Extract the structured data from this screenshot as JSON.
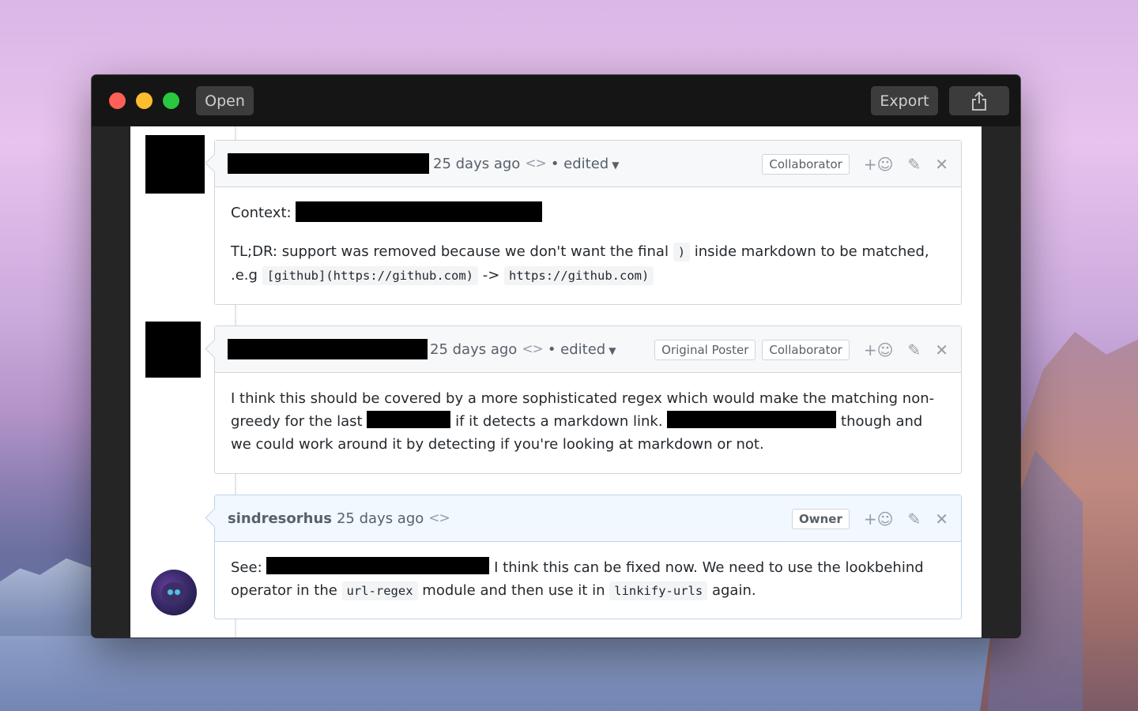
{
  "window": {
    "open_label": "Open",
    "export_label": "Export",
    "share_icon": "share-icon"
  },
  "comments": [
    {
      "time": "25 days ago",
      "code_icon": "<>",
      "edited": "• edited",
      "badges": [
        "Collaborator"
      ],
      "body": {
        "context_label": "Context:",
        "tldr_text_1": "TL;DR: support was removed because we don't want the final",
        "tldr_code_1": ")",
        "tldr_text_2": "inside markdown to be matched,",
        "eg_text": ".e.g",
        "eg_code_1": "[github](https://github.com)",
        "eg_arrow": "->",
        "eg_code_2": "https://github.com)"
      }
    },
    {
      "time": "25 days ago",
      "code_icon": "<>",
      "edited": "• edited",
      "badges": [
        "Original Poster",
        "Collaborator"
      ],
      "body": {
        "text_1": "I think this should be covered by a more sophisticated regex which would make the matching non-greedy for the last",
        "text_2": "if it detects a markdown link.",
        "text_3": "though and we could work around it by detecting if you're looking at markdown or not."
      }
    },
    {
      "author": "sindresorhus",
      "time": "25 days ago",
      "code_icon": "<>",
      "badges": [
        "Owner"
      ],
      "body": {
        "see_label": "See:",
        "text_1": "I think this can be fixed now. We need to use the lookbehind operator in the",
        "code_1": "url-regex",
        "text_2": "module and then use it in",
        "code_2": "linkify-urls",
        "text_3": "again."
      }
    }
  ],
  "icons": {
    "add_reaction": "+☺",
    "edit": "✎",
    "close": "✕"
  }
}
